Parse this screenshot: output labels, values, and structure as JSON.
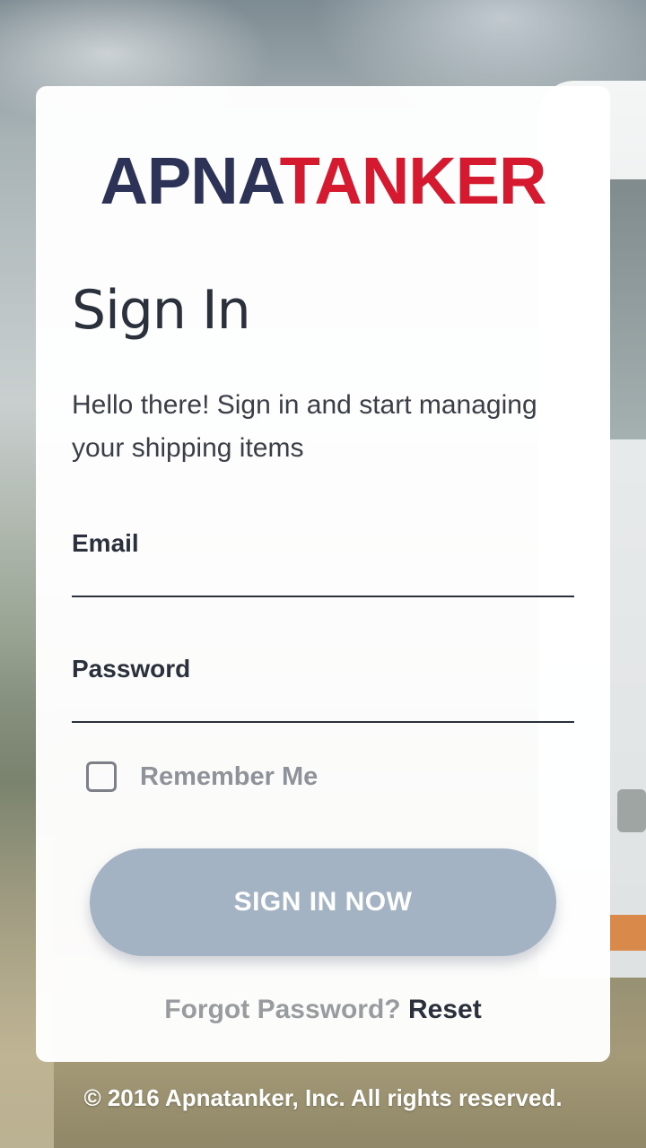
{
  "brand": {
    "logo_part1": "APNA",
    "logo_part2": "TANKER",
    "logo_color_primary": "#2c3357",
    "logo_color_accent": "#d5192f"
  },
  "signin": {
    "title": "Sign In",
    "subtitle": "Hello there! Sign in and start managing your shipping items",
    "email_label": "Email",
    "email_value": "",
    "password_label": "Password",
    "password_value": "",
    "remember_label": "Remember Me",
    "remember_checked": false,
    "submit_label": "SIGN IN NOW",
    "submit_color": "#a3b3c4",
    "forgot_text": "Forgot Password?",
    "reset_link": "Reset"
  },
  "footer": {
    "copyright": "© 2016 Apnatanker, Inc. All rights reserved."
  }
}
